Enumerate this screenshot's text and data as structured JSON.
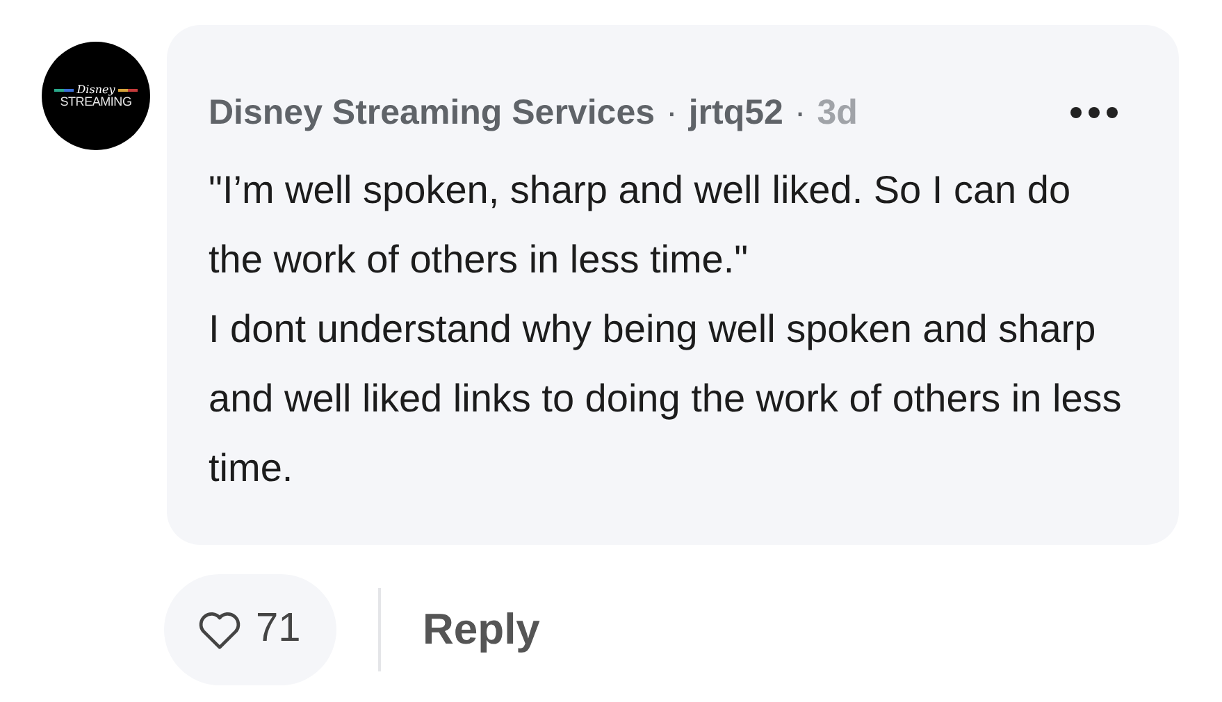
{
  "avatar": {
    "logo_script": "Disney",
    "logo_text": "STREAMING"
  },
  "comment": {
    "author": "Disney Streaming Services",
    "separator_1": "·",
    "username": "jrtq52",
    "separator_2": "·",
    "age": "3d",
    "paragraphs": [
      "\"I’m well spoken, sharp and well liked. So I can do the work of others in less time.\"",
      "I dont understand why being well spoken and sharp and well liked links to doing the work of others in less time."
    ]
  },
  "actions": {
    "likes": "71",
    "reply": "Reply"
  }
}
